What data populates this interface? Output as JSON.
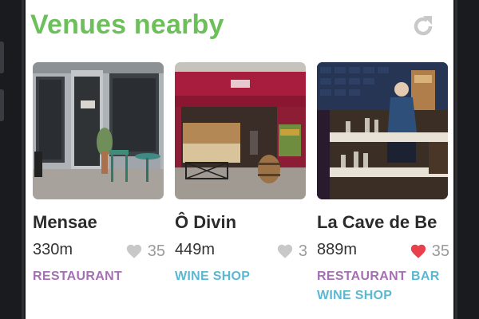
{
  "header": {
    "title": "Venues nearby",
    "refresh_icon": "refresh-icon"
  },
  "colors": {
    "title_green": "#6dbf5b",
    "restaurant": "#a56fb3",
    "wine_shop": "#5bb8d2",
    "bar": "#5bb8d2",
    "heart_liked": "#e8414d",
    "heart_default": "#c8c8c8"
  },
  "venues": [
    {
      "name": "Mensae",
      "distance": "330m",
      "likes": "35",
      "liked": false,
      "heart_icon": "heart-icon",
      "tags": [
        {
          "label": "RESTAURANT",
          "color": "#a56fb3"
        }
      ]
    },
    {
      "name": "Ô Divin",
      "distance": "449m",
      "likes": "3",
      "liked": false,
      "heart_icon": "heart-icon",
      "tags": [
        {
          "label": "WINE SHOP",
          "color": "#5bb8d2"
        }
      ]
    },
    {
      "name": "La Cave de Be",
      "distance": "889m",
      "likes": "35",
      "liked": true,
      "heart_icon": "heart-icon",
      "tags": [
        {
          "label": "RESTAURANT",
          "color": "#a56fb3"
        },
        {
          "label": "BAR",
          "color": "#5bb8d2"
        },
        {
          "label": "WINE SHOP",
          "color": "#5bb8d2"
        }
      ]
    }
  ]
}
